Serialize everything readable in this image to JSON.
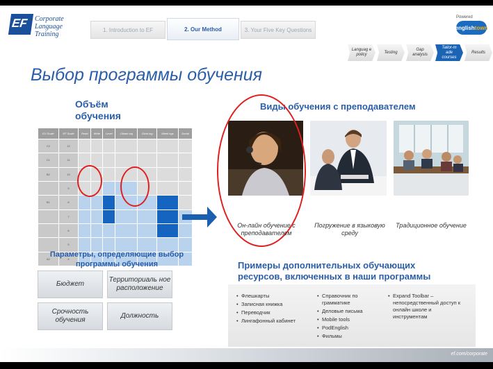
{
  "header": {
    "logo_mark": "EF",
    "logo_line1": "Corporate",
    "logo_line2": "Language Training",
    "tabs": [
      {
        "label": "1. Introduction to EF"
      },
      {
        "label": "2. Our Method"
      },
      {
        "label": "3. Your Five Key Questions"
      }
    ],
    "powered_label": "Powered",
    "powered_logo": "englishtown"
  },
  "steps": [
    {
      "label": "Languag e policy"
    },
    {
      "label": "Testing"
    },
    {
      "label": "Gap analysis"
    },
    {
      "label": "Tailor-m ade courses"
    },
    {
      "label": "Results"
    }
  ],
  "title": "Выбор программы обучения",
  "left": {
    "volume_title": "Объём обучения",
    "grid_headers": [
      "EU Scale",
      "EF Scale",
      "Read",
      "Write",
      "Level",
      "Obtain ing",
      "Givin ing",
      "Meeti ngs",
      "Social"
    ],
    "grid_rows": [
      {
        "eu": "C2",
        "ef": "12"
      },
      {
        "eu": "C1",
        "ef": "11"
      },
      {
        "eu": "B2",
        "ef": "10"
      },
      {
        "eu": "",
        "ef": "9"
      },
      {
        "eu": "B1",
        "ef": "8"
      },
      {
        "eu": "",
        "ef": "7"
      },
      {
        "eu": "",
        "ef": "6"
      },
      {
        "eu": "",
        "ef": "5"
      },
      {
        "eu": "A2",
        "ef": "4"
      }
    ],
    "params_title": "Параметры, определяющие выбор программы обучения",
    "params": {
      "budget": "Бюджет",
      "location": "Территориаль ное расположение",
      "urgency": "Срочность обучения",
      "position": "Должность"
    }
  },
  "right": {
    "types_title": "Виды обучения с преподавателем",
    "types": [
      {
        "label": "Он-лайн обучение с преподавателем"
      },
      {
        "label": "Погружение в языковую среду"
      },
      {
        "label": "Традиционное обучение"
      }
    ],
    "resources_title": "Примеры дополнительных обучающих ресурсов, включенных в наши программы",
    "resources_col1": [
      "Флешкарты",
      "Записная книжка",
      "Переводчик",
      "Лингафонный кабинет"
    ],
    "resources_col2": [
      "Справочник по грамматике",
      "Деловые письма",
      "Mobile tools",
      "PodEnglish",
      "Фильмы"
    ],
    "resources_col3": [
      "Expand Toolbar – непосредственный доступ к онлайн школе и инструментам"
    ]
  },
  "footer": {
    "text": "ef.com/corporate"
  },
  "colors": {
    "accent": "#2a5ea8",
    "highlight": "#1565c0",
    "circle": "#e02020"
  }
}
